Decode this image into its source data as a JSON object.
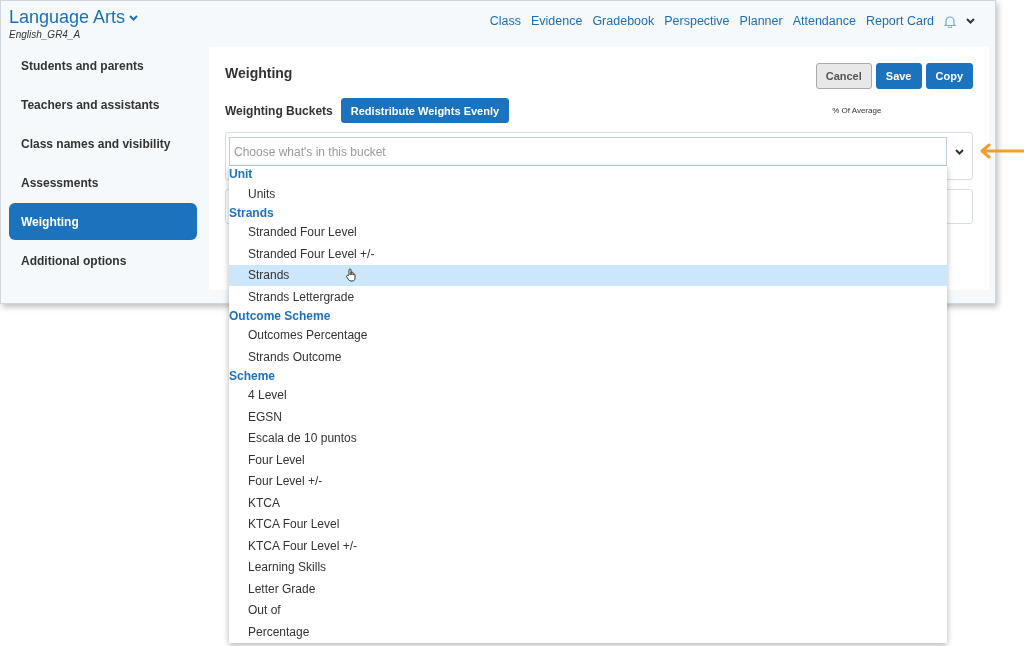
{
  "header": {
    "title": "Language Arts",
    "subtitle": "English_GR4_A",
    "nav": [
      "Class",
      "Evidence",
      "Gradebook",
      "Perspective",
      "Planner",
      "Attendance",
      "Report Card"
    ]
  },
  "sidebar": {
    "items": [
      {
        "label": "Students and parents",
        "selected": false
      },
      {
        "label": "Teachers and assistants",
        "selected": false
      },
      {
        "label": "Class names and visibility",
        "selected": false
      },
      {
        "label": "Assessments",
        "selected": false
      },
      {
        "label": "Weighting",
        "selected": true
      },
      {
        "label": "Additional options",
        "selected": false
      }
    ]
  },
  "content": {
    "title": "Weighting",
    "buttons": [
      {
        "label": "Cancel",
        "kind": "secondary"
      },
      {
        "label": "Save",
        "kind": "primary"
      },
      {
        "label": "Copy",
        "kind": "primary"
      }
    ],
    "buckets_label": "Weighting Buckets",
    "redistribute_button": "Redistribute Weights Evenly",
    "column_header": "% Of Average",
    "bucket_field": {
      "placeholder": "Choose what's in this bucket"
    }
  },
  "dropdown": {
    "groups": [
      {
        "label": "Unit",
        "options": [
          {
            "label": "Units",
            "selected": false
          }
        ]
      },
      {
        "label": "Strands",
        "options": [
          {
            "label": "Stranded Four Level",
            "selected": false
          },
          {
            "label": "Stranded Four Level +/-",
            "selected": false
          },
          {
            "label": "Strands",
            "selected": true
          },
          {
            "label": "Strands Lettergrade",
            "selected": false
          }
        ]
      },
      {
        "label": "Outcome Scheme",
        "options": [
          {
            "label": "Outcomes Percentage",
            "selected": false
          },
          {
            "label": "Strands Outcome",
            "selected": false
          }
        ]
      },
      {
        "label": "Scheme",
        "options": [
          {
            "label": "4 Level",
            "selected": false
          },
          {
            "label": "EGSN",
            "selected": false
          },
          {
            "label": "Escala de 10 puntos",
            "selected": false
          },
          {
            "label": "Four Level",
            "selected": false
          },
          {
            "label": "Four Level +/-",
            "selected": false
          },
          {
            "label": "KTCA",
            "selected": false
          },
          {
            "label": "KTCA Four Level",
            "selected": false
          },
          {
            "label": "KTCA Four Level +/-",
            "selected": false
          },
          {
            "label": "Learning Skills",
            "selected": false
          },
          {
            "label": "Letter Grade",
            "selected": false
          },
          {
            "label": "Out of",
            "selected": false
          },
          {
            "label": "Percentage",
            "selected": false
          }
        ]
      }
    ]
  }
}
